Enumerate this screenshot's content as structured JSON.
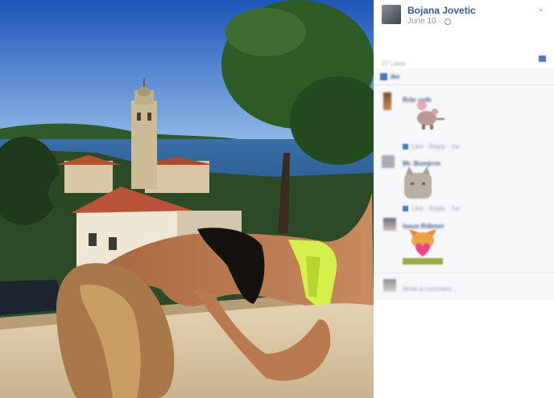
{
  "post": {
    "author": "Bojana Jovetic",
    "date": "June 10 · "
  },
  "icons": {
    "privacy": "globe-icon",
    "options": "chevron-down-icon",
    "share": "share-icon",
    "like": "thumbs-up-icon",
    "reply": "reply-arrow-icon"
  },
  "pixelated": {
    "likes_count": "27 Likes",
    "like_row": "ike",
    "comment1_name": "Rrbr uslh",
    "comment1_meta": "Like · Reply · 1w",
    "comment2_name": "Mr. Bumjrrm",
    "comment2_meta": "Like · Reply · 1w",
    "comment3_name": "Iseus Rdbmrr",
    "comment3_meta": "Like · Reply · 1w",
    "comment4_text": "Write a comment..."
  },
  "colors": {
    "name_link": "#365899",
    "meta_text": "#90949c",
    "comments_bg": "#f6f7f9"
  }
}
